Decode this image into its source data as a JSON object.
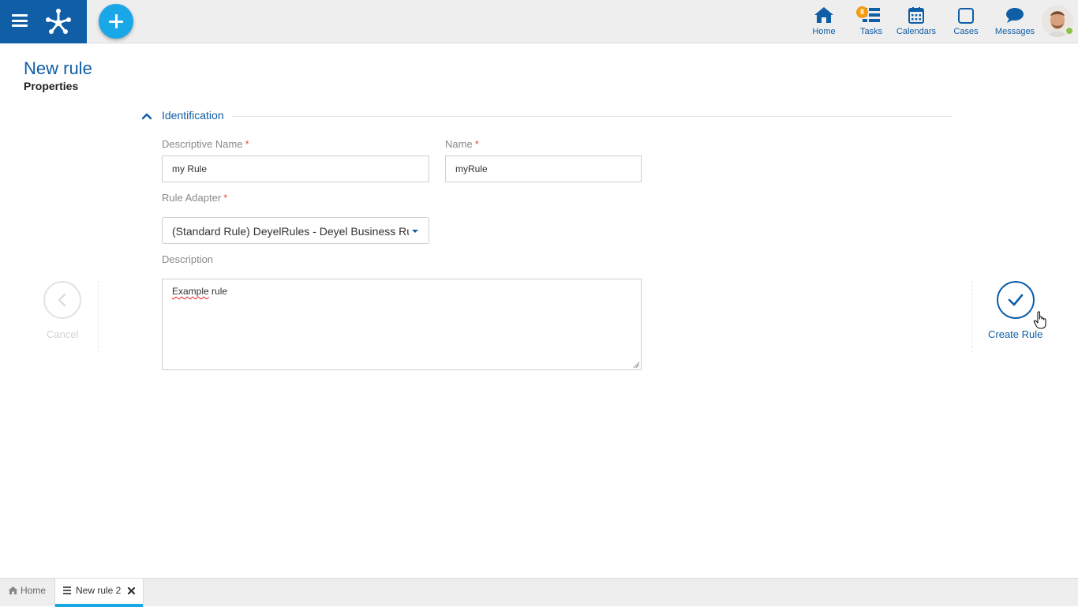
{
  "topbar": {
    "nav": [
      {
        "key": "home",
        "label": "Home",
        "icon": "home-icon"
      },
      {
        "key": "tasks",
        "label": "Tasks",
        "icon": "tasks-icon",
        "badge": "8"
      },
      {
        "key": "calendars",
        "label": "Calendars",
        "icon": "calendar-icon"
      },
      {
        "key": "cases",
        "label": "Cases",
        "icon": "cases-icon"
      },
      {
        "key": "messages",
        "label": "Messages",
        "icon": "message-icon"
      }
    ],
    "user_status": "online"
  },
  "page": {
    "title": "New rule",
    "subtitle": "Properties"
  },
  "section": {
    "title": "Identification",
    "expanded": true
  },
  "form": {
    "descriptive_name": {
      "label": "Descriptive Name",
      "required_mark": "*",
      "value": "my Rule"
    },
    "name": {
      "label": "Name",
      "required_mark": "*",
      "value": "myRule"
    },
    "rule_adapter": {
      "label": "Rule Adapter",
      "required_mark": "*",
      "selected": "(Standard Rule) DeyelRules - Deyel Business Rules"
    },
    "description": {
      "label": "Description",
      "value_misspelled": "Example",
      "value_rest": " rule"
    }
  },
  "actions": {
    "cancel": {
      "label": "Cancel",
      "enabled": false
    },
    "create": {
      "label": "Create Rule",
      "enabled": true
    }
  },
  "bottom_tabs": [
    {
      "label": "Home",
      "icon": "home-icon",
      "active": false
    },
    {
      "label": "New rule 2",
      "icon": "form-icon",
      "active": true,
      "closable": true
    }
  ],
  "colors": {
    "brand": "#0f5ea6",
    "accent": "#1aa7e8",
    "badge": "#f39c12",
    "required": "#d9534f",
    "online": "#8bc34a"
  }
}
